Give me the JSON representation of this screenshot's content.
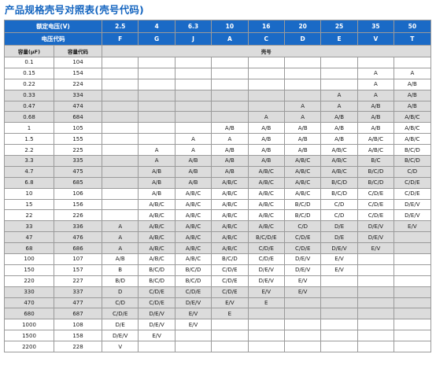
{
  "title": "产品规格壳号对照表(壳号代码)",
  "header": {
    "rated_voltage_label": "额定电压(V)",
    "voltage_code_label": "电压代码",
    "voltages": [
      "2.5",
      "4",
      "6.3",
      "10",
      "16",
      "20",
      "25",
      "35",
      "50"
    ],
    "voltage_codes": [
      "F",
      "G",
      "J",
      "A",
      "C",
      "D",
      "E",
      "V",
      "T"
    ],
    "capacitance_label": "容量(μF)",
    "capacitance_code_label": "容量代码",
    "case_label": "壳号"
  },
  "highlight_color": "#ffff66",
  "highlighted_cell": {
    "row": 32,
    "col": 3
  },
  "rows": [
    {
      "cap": "0.1",
      "code": "104",
      "cells": [
        "",
        "",
        "",
        "",
        "",
        "",
        "",
        "",
        ""
      ]
    },
    {
      "cap": "0.15",
      "code": "154",
      "cells": [
        "",
        "",
        "",
        "",
        "",
        "",
        "",
        "A",
        "A"
      ]
    },
    {
      "cap": "0.22",
      "code": "224",
      "cells": [
        "",
        "",
        "",
        "",
        "",
        "",
        "",
        "A",
        "A/B"
      ]
    },
    {
      "cap": "0.33",
      "code": "334",
      "cells": [
        "",
        "",
        "",
        "",
        "",
        "",
        "A",
        "A",
        "A/B"
      ]
    },
    {
      "cap": "0.47",
      "code": "474",
      "cells": [
        "",
        "",
        "",
        "",
        "",
        "A",
        "A",
        "A/B",
        "A/B"
      ]
    },
    {
      "cap": "0.68",
      "code": "684",
      "cells": [
        "",
        "",
        "",
        "",
        "A",
        "A",
        "A/B",
        "A/B",
        "A/B/C"
      ]
    },
    {
      "cap": "1",
      "code": "105",
      "cells": [
        "",
        "",
        "",
        "A/B",
        "A/B",
        "A/B",
        "A/B",
        "A/B",
        "A/B/C"
      ]
    },
    {
      "cap": "1.5",
      "code": "155",
      "cells": [
        "",
        "",
        "A",
        "A",
        "A/B",
        "A/B",
        "A/B",
        "A/B/C",
        "A/B/C"
      ]
    },
    {
      "cap": "2.2",
      "code": "225",
      "cells": [
        "",
        "A",
        "A",
        "A/B",
        "A/B",
        "A/B",
        "A/B/C",
        "A/B/C",
        "B/C/D"
      ]
    },
    {
      "cap": "3.3",
      "code": "335",
      "cells": [
        "",
        "A",
        "A/B",
        "A/B",
        "A/B",
        "A/B/C",
        "A/B/C",
        "B/C",
        "B/C/D"
      ]
    },
    {
      "cap": "4.7",
      "code": "475",
      "cells": [
        "",
        "A/B",
        "A/B",
        "A/B",
        "A/B/C",
        "A/B/C",
        "A/B/C",
        "B/C/D",
        "C/D"
      ]
    },
    {
      "cap": "6.8",
      "code": "685",
      "cells": [
        "",
        "A/B",
        "A/B",
        "A/B/C",
        "A/B/C",
        "A/B/C",
        "B/C/D",
        "B/C/D",
        "C/D/E"
      ]
    },
    {
      "cap": "10",
      "code": "106",
      "cells": [
        "",
        "A/B",
        "A/B/C",
        "A/B/C",
        "A/B/C",
        "A/B/C",
        "B/C/D",
        "C/D/E",
        "C/D/E"
      ]
    },
    {
      "cap": "15",
      "code": "156",
      "cells": [
        "",
        "A/B/C",
        "A/B/C",
        "A/B/C",
        "A/B/C",
        "B/C/D",
        "C/D",
        "C/D/E",
        "D/E/V"
      ]
    },
    {
      "cap": "22",
      "code": "226",
      "cells": [
        "",
        "A/B/C",
        "A/B/C",
        "A/B/C",
        "A/B/C",
        "B/C/D",
        "C/D",
        "C/D/E",
        "D/E/V"
      ]
    },
    {
      "cap": "33",
      "code": "336",
      "cells": [
        "A",
        "A/B/C",
        "A/B/C",
        "A/B/C",
        "A/B/C",
        "C/D",
        "D/E",
        "D/E/V",
        "E/V"
      ]
    },
    {
      "cap": "47",
      "code": "476",
      "cells": [
        "A",
        "A/B/C",
        "A/B/C",
        "A/B/C",
        "B/C/D/E",
        "C/D/E",
        "D/E",
        "D/E/V",
        ""
      ]
    },
    {
      "cap": "68",
      "code": "686",
      "cells": [
        "A",
        "A/B/C",
        "A/B/C",
        "A/B/C",
        "C/D/E",
        "C/D/E",
        "D/E/V",
        "E/V",
        ""
      ]
    },
    {
      "cap": "100",
      "code": "107",
      "cells": [
        "A/B",
        "A/B/C",
        "A/B/C",
        "B/C/D",
        "C/D/E",
        "D/E/V",
        "E/V",
        "",
        ""
      ]
    },
    {
      "cap": "150",
      "code": "157",
      "cells": [
        "B",
        "B/C/D",
        "B/C/D",
        "C/D/E",
        "D/E/V",
        "D/E/V",
        "E/V",
        "",
        ""
      ]
    },
    {
      "cap": "220",
      "code": "227",
      "cells": [
        "B/D",
        "B/C/D",
        "B/C/D",
        "C/D/E",
        "D/E/V",
        "E/V",
        "",
        "",
        ""
      ]
    },
    {
      "cap": "330",
      "code": "337",
      "cells": [
        "D",
        "C/D/E",
        "C/D/E",
        "C/D/E",
        "E/V",
        "E/V",
        "",
        "",
        ""
      ]
    },
    {
      "cap": "470",
      "code": "477",
      "cells": [
        "C/D",
        "C/D/E",
        "D/E/V",
        "E/V",
        "E",
        "",
        "",
        "",
        ""
      ]
    },
    {
      "cap": "680",
      "code": "687",
      "cells": [
        "C/D/E",
        "D/E/V",
        "E/V",
        "E",
        "",
        "",
        "",
        "",
        ""
      ]
    },
    {
      "cap": "1000",
      "code": "108",
      "cells": [
        "D/E",
        "D/E/V",
        "E/V",
        "",
        "",
        "",
        "",
        "",
        ""
      ]
    },
    {
      "cap": "1500",
      "code": "158",
      "cells": [
        "D/E/V",
        "E/V",
        "",
        "",
        "",
        "",
        "",
        "",
        ""
      ]
    },
    {
      "cap": "2200",
      "code": "228",
      "cells": [
        "V",
        "",
        "",
        "",
        "",
        "",
        "",
        "",
        ""
      ]
    }
  ]
}
